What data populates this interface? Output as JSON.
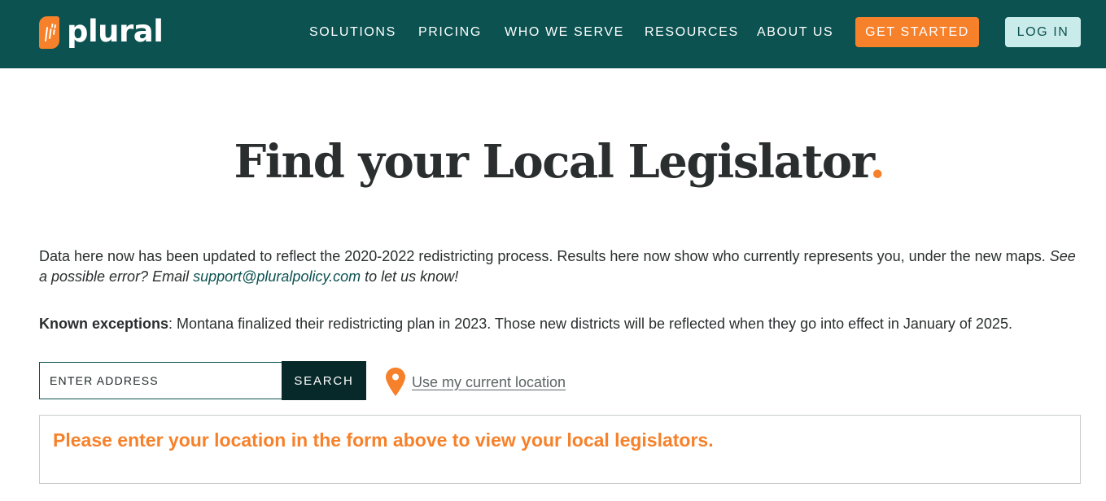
{
  "header": {
    "logo_text": "plural",
    "nav": [
      {
        "label": "SOLUTIONS"
      },
      {
        "label": "PRICING"
      },
      {
        "label": "WHO WE SERVE"
      },
      {
        "label": "RESOURCES"
      },
      {
        "label": "ABOUT US"
      }
    ],
    "get_started_label": "GET STARTED",
    "login_label": "LOG IN"
  },
  "colors": {
    "brand_dark": "#0b5250",
    "accent_orange": "#f7812a",
    "login_bg": "#c9ebea",
    "search_bg": "#07292a"
  },
  "main": {
    "title": "Find your Local Legislator",
    "title_dot": ".",
    "intro": {
      "text": "Data here now has been updated to reflect the 2020-2022 redistricting process. Results here now show who currently represents you, under the new maps.",
      "error_prefix": "See a possible error? Email",
      "email": "support@pluralpolicy.com",
      "error_suffix": "to let us know!"
    },
    "exceptions": {
      "label": "Known exceptions",
      "text": ": Montana finalized their redistricting plan in 2023. Those new districts will be reflected when they go into effect in January of 2025."
    },
    "search": {
      "placeholder": "ENTER ADDRESS",
      "value": "",
      "button_label": "SEARCH",
      "location_icon": "map-pin-icon",
      "location_label": "Use my current location"
    },
    "results_message": "Please enter your location in the form above to view your local legislators."
  }
}
